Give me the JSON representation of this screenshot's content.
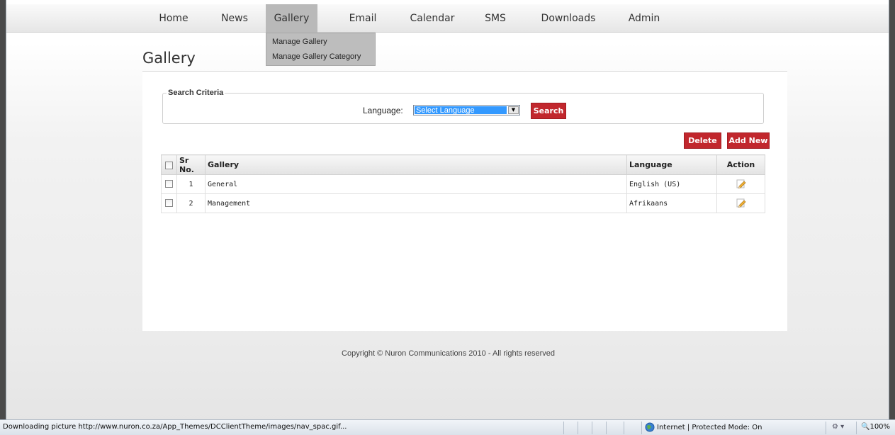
{
  "nav": {
    "items": [
      {
        "label": "Home"
      },
      {
        "label": "News"
      },
      {
        "label": "Gallery"
      },
      {
        "label": "Email"
      },
      {
        "label": "Calendar"
      },
      {
        "label": "SMS"
      },
      {
        "label": "Downloads"
      },
      {
        "label": "Admin"
      }
    ],
    "active": "Gallery",
    "dropdown": [
      "Manage Gallery",
      "Manage Gallery Category"
    ]
  },
  "page": {
    "title": "Gallery"
  },
  "search": {
    "legend": "Search Criteria",
    "language_label": "Language:",
    "language_value": "Select Language",
    "button": "Search"
  },
  "actions": {
    "delete": "Delete",
    "add_new": "Add New"
  },
  "table": {
    "headers": {
      "sr": "Sr No.",
      "gallery": "Gallery",
      "language": "Language",
      "action": "Action"
    },
    "rows": [
      {
        "sr": "1",
        "gallery": "General",
        "language": "English (US)"
      },
      {
        "sr": "2",
        "gallery": "Management",
        "language": "Afrikaans"
      }
    ]
  },
  "footer": {
    "copyright": "Copyright © Nuron Communications 2010 - All rights reserved"
  },
  "statusbar": {
    "message": "Downloading picture http://www.nuron.co.za/App_Themes/DCClientTheme/images/nav_spac.gif...",
    "zone": "Internet | Protected Mode: On",
    "zoom": "100%"
  },
  "colors": {
    "accent": "#c1272d",
    "nav_active": "#b9b9b9"
  }
}
